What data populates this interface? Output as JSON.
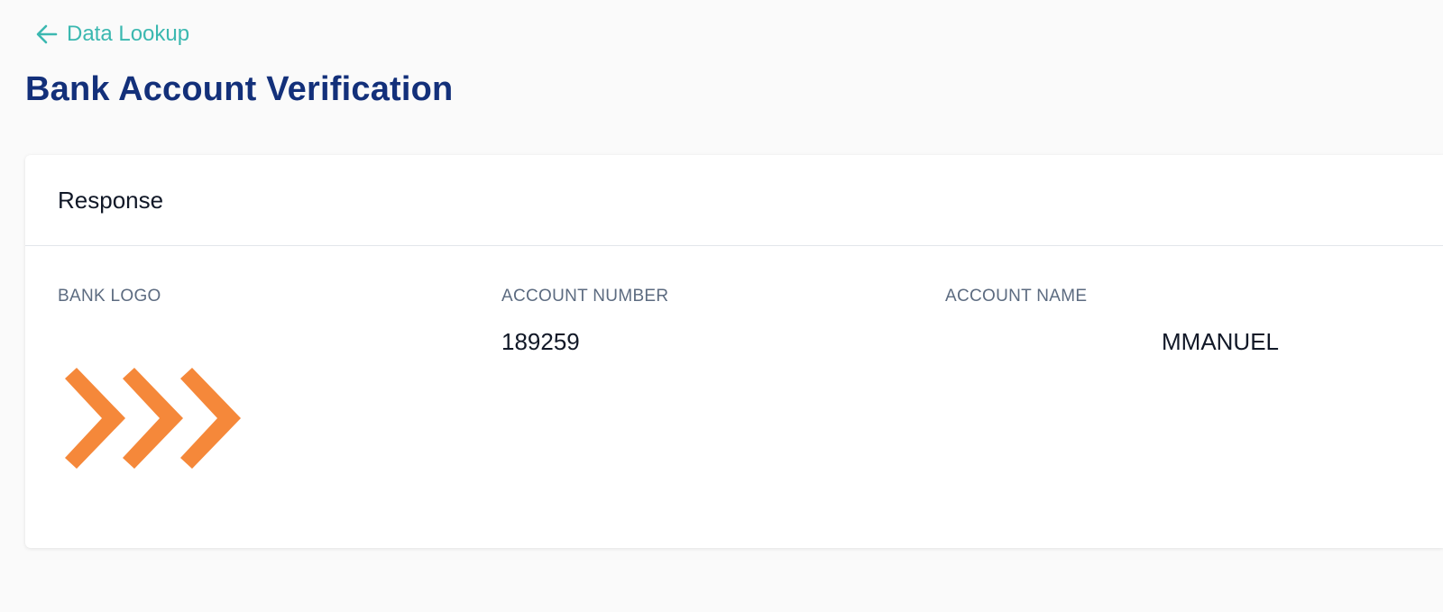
{
  "nav": {
    "back_label": "Data Lookup",
    "back_icon": "arrow-left-icon"
  },
  "page": {
    "title": "Bank Account Verification"
  },
  "response": {
    "header": "Response",
    "fields": {
      "bank_logo_label": "BANK LOGO",
      "account_number_label": "ACCOUNT NUMBER",
      "account_number_value": "189259",
      "account_name_label": "ACCOUNT NAME",
      "account_name_value": "MMANUEL"
    },
    "bank_logo_icon": "triple-chevron-logo-icon",
    "bank_logo_color": "#f5883a"
  },
  "colors": {
    "accent": "#3bb8b0",
    "title": "#13307a",
    "label": "#5c6b80",
    "text": "#111827",
    "background": "#fafafa"
  }
}
